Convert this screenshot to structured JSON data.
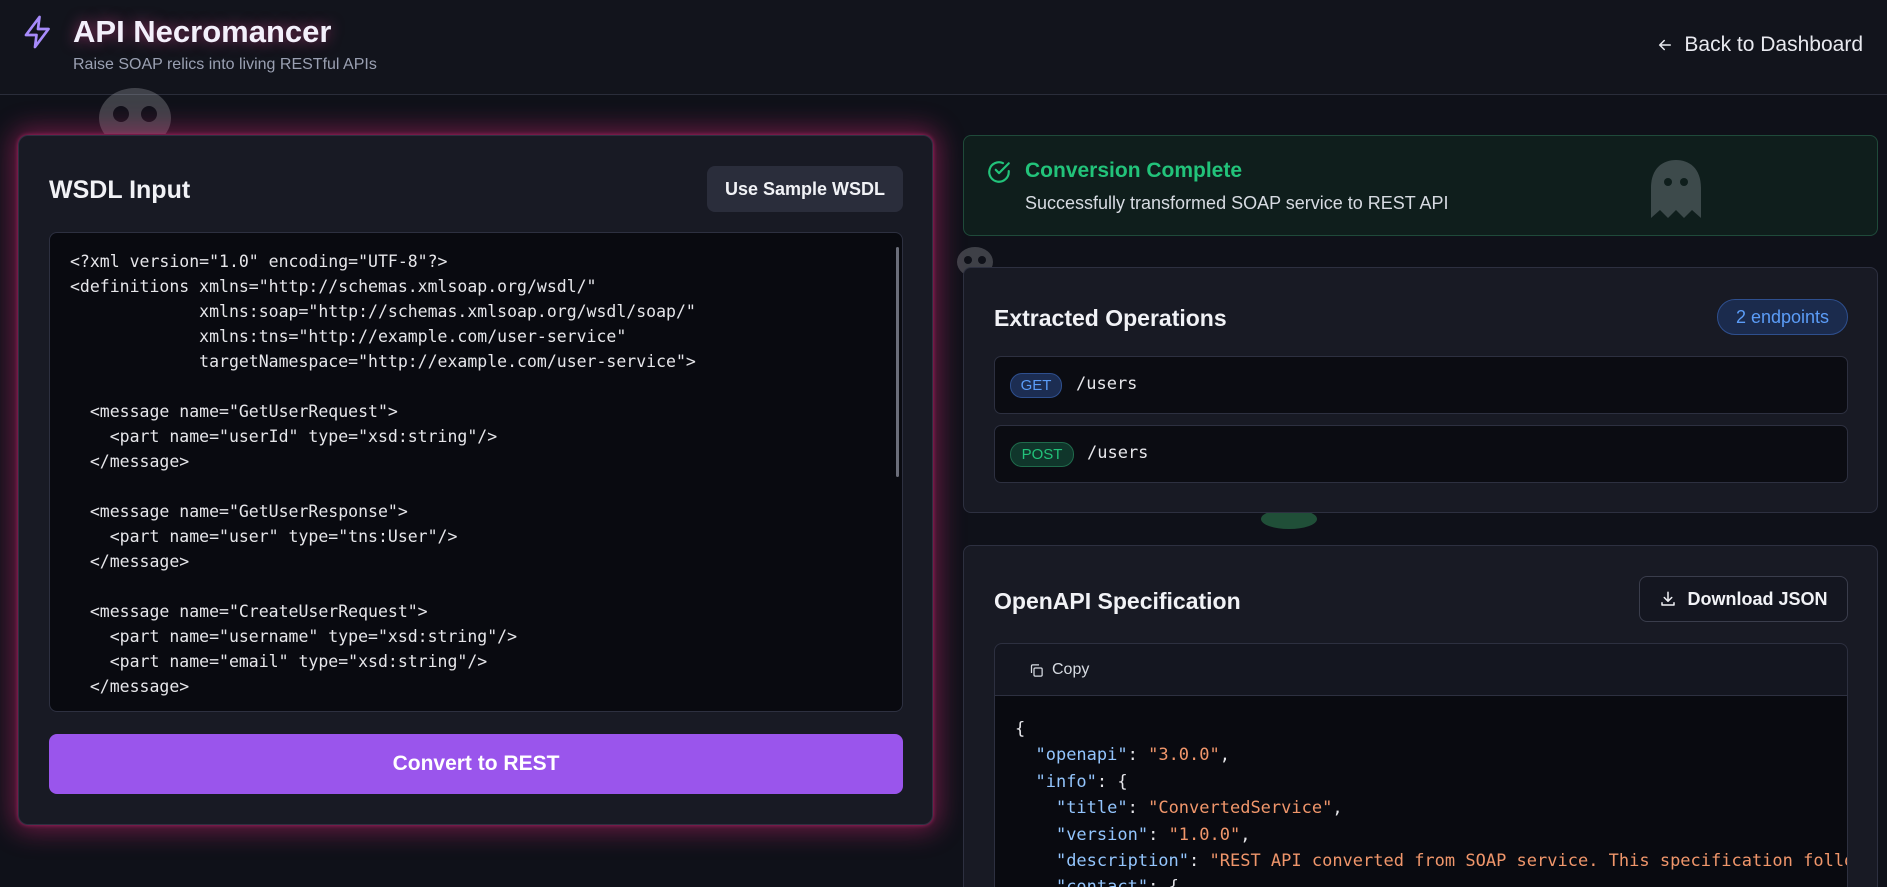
{
  "header": {
    "title": "API Necromancer",
    "subtitle": "Raise SOAP relics into living RESTful APIs",
    "back_label": "Back to Dashboard"
  },
  "wsdl_panel": {
    "title": "WSDL Input",
    "sample_button": "Use Sample WSDL",
    "convert_button": "Convert to REST",
    "code": "<?xml version=\"1.0\" encoding=\"UTF-8\"?>\n<definitions xmlns=\"http://schemas.xmlsoap.org/wsdl/\"\n             xmlns:soap=\"http://schemas.xmlsoap.org/wsdl/soap/\"\n             xmlns:tns=\"http://example.com/user-service\"\n             targetNamespace=\"http://example.com/user-service\">\n\n  <message name=\"GetUserRequest\">\n    <part name=\"userId\" type=\"xsd:string\"/>\n  </message>\n\n  <message name=\"GetUserResponse\">\n    <part name=\"user\" type=\"tns:User\"/>\n  </message>\n\n  <message name=\"CreateUserRequest\">\n    <part name=\"username\" type=\"xsd:string\"/>\n    <part name=\"email\" type=\"xsd:string\"/>\n  </message>"
  },
  "status": {
    "title": "Conversion Complete",
    "message": "Successfully transformed SOAP service to REST API"
  },
  "operations": {
    "title": "Extracted Operations",
    "count_badge": "2 endpoints",
    "items": [
      {
        "method": "GET",
        "path": "/users"
      },
      {
        "method": "POST",
        "path": "/users"
      }
    ]
  },
  "spec": {
    "title": "OpenAPI Specification",
    "download_label": "Download JSON",
    "copy_label": "Copy",
    "lines": [
      {
        "indent": "",
        "key": "",
        "val": "",
        "tail": "{"
      },
      {
        "indent": "  ",
        "key": "\"openapi\"",
        "val": "\"3.0.0\"",
        "tail": ","
      },
      {
        "indent": "  ",
        "key": "\"info\"",
        "val": "",
        "tail": "{"
      },
      {
        "indent": "    ",
        "key": "\"title\"",
        "val": "\"ConvertedService\"",
        "tail": ","
      },
      {
        "indent": "    ",
        "key": "\"version\"",
        "val": "\"1.0.0\"",
        "tail": ","
      },
      {
        "indent": "    ",
        "key": "\"description\"",
        "val": "\"REST API converted from SOAP service. This specification follows O",
        "tail": ""
      },
      {
        "indent": "    ",
        "key": "\"contact\"",
        "val": "",
        "tail": "{"
      }
    ]
  },
  "colors": {
    "accent": "#9a55ec",
    "glow": "#db2777",
    "success": "#22c37a",
    "info": "#5b9cf7"
  },
  "icons": {
    "logo": "lightning-bolt-icon",
    "back": "arrow-left-icon",
    "status": "check-circle-icon",
    "download": "download-icon",
    "copy": "copy-icon",
    "decorations": [
      "skull-icon",
      "ghost-icon",
      "small-skull-icon",
      "zombie-icon"
    ]
  }
}
